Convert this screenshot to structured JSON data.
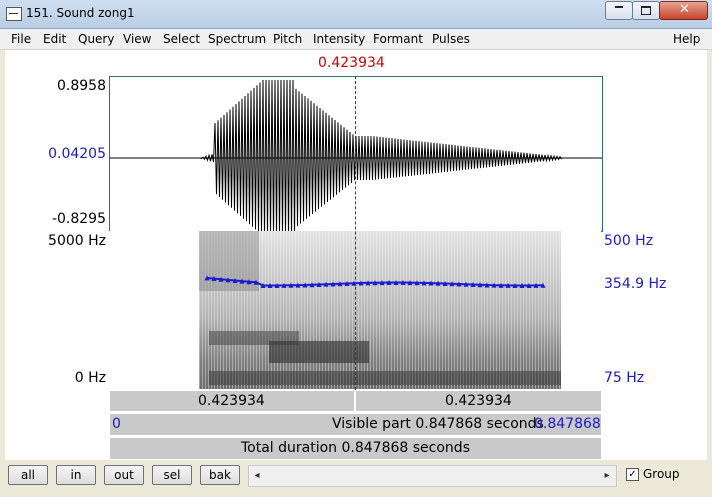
{
  "window": {
    "title": "151. Sound zong1"
  },
  "menu": [
    "File",
    "Edit",
    "Query",
    "View",
    "Select",
    "Spectrum",
    "Pitch",
    "Intensity",
    "Formant",
    "Pulses"
  ],
  "help": "Help",
  "cursor": {
    "time_label": "0.423934"
  },
  "waveform": {
    "max": "0.8958",
    "mid": "0.04205",
    "min": "-0.8295"
  },
  "spectrogram": {
    "top_left": "5000 Hz",
    "bottom_left": "0 Hz"
  },
  "pitch": {
    "top": "500 Hz",
    "value": "354.9 Hz",
    "bottom": "75 Hz"
  },
  "bars": {
    "left_time": "0.423934",
    "right_time": "0.423934",
    "visible_start": "0",
    "visible_text": "Visible part 0.847868 seconds",
    "visible_end": "0.847868",
    "total": "Total duration 0.847868 seconds"
  },
  "buttons": {
    "all": "all",
    "in": "in",
    "out": "out",
    "sel": "sel",
    "bak": "bak"
  },
  "group": {
    "label": "Group",
    "checked": "✓"
  },
  "icons": {
    "minimize": "minimize-icon",
    "maximize": "maximize-icon",
    "close": "close-icon",
    "scroll_left": "◂",
    "scroll_right": "▸"
  }
}
